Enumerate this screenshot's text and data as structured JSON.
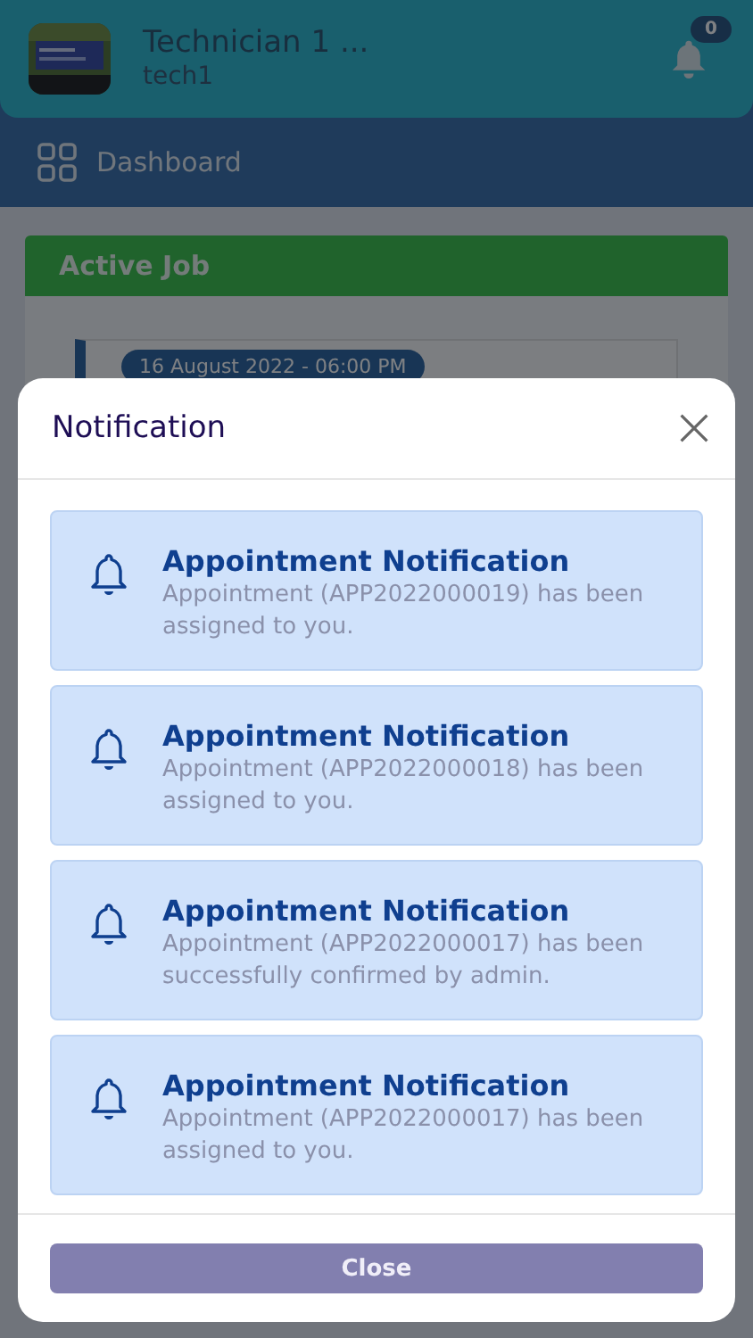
{
  "header": {
    "name": "Technician 1 ...",
    "username": "tech1",
    "notification_count": "0"
  },
  "nav": {
    "label": "Dashboard"
  },
  "active_job": {
    "title": "Active Job",
    "date": "16 August 2022 - 06:00 PM"
  },
  "modal": {
    "title": "Notification",
    "close_button": "Close",
    "notifications": [
      {
        "title": "Appointment Notification",
        "message": "Appointment (APP2022000019) has been assigned to you."
      },
      {
        "title": "Appointment Notification",
        "message": "Appointment (APP2022000018) has been assigned to you."
      },
      {
        "title": "Appointment Notification",
        "message": "Appointment (APP2022000017) has been successfully confirmed by admin."
      },
      {
        "title": "Appointment Notification",
        "message": "Appointment (APP2022000017) has been assigned to you."
      }
    ]
  }
}
